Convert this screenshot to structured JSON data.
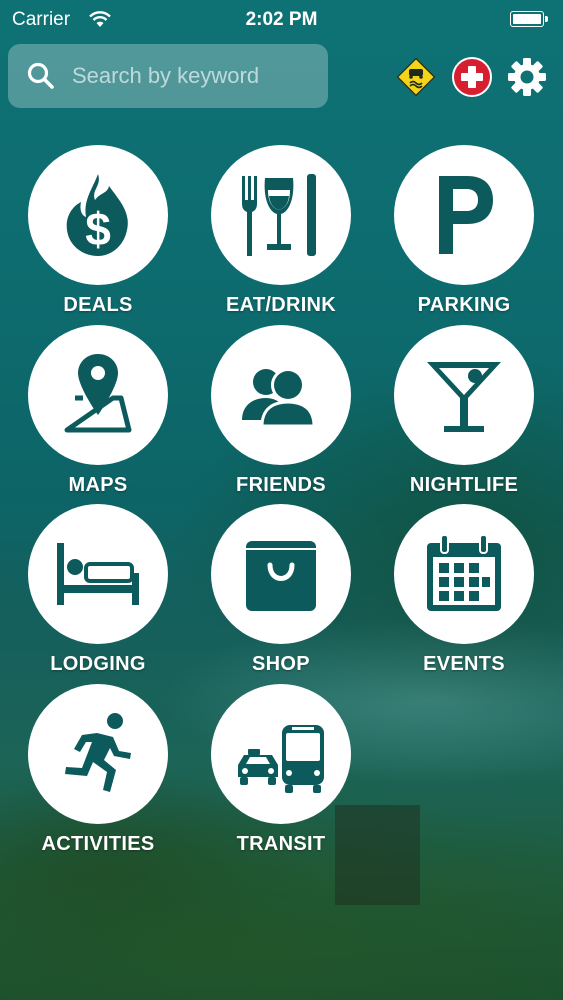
{
  "status_bar": {
    "carrier": "Carrier",
    "time": "2:02 PM"
  },
  "search": {
    "placeholder": "Search by keyword"
  },
  "header_icons": [
    {
      "name": "road-conditions-icon"
    },
    {
      "name": "emergency-icon"
    },
    {
      "name": "gear-icon"
    }
  ],
  "colors": {
    "tile_icon": "#0d5a5c",
    "emergency": "#d71f32",
    "road_sign": "#f4d418"
  },
  "categories": [
    {
      "label": "DEALS",
      "icon": "deals-fire-dollar-icon"
    },
    {
      "label": "EAT/DRINK",
      "icon": "fork-wine-knife-icon"
    },
    {
      "label": "PARKING",
      "icon": "parking-p-icon"
    },
    {
      "label": "MAPS",
      "icon": "map-pin-icon"
    },
    {
      "label": "FRIENDS",
      "icon": "friends-people-icon"
    },
    {
      "label": "NIGHTLIFE",
      "icon": "martini-glass-icon"
    },
    {
      "label": "LODGING",
      "icon": "bed-icon"
    },
    {
      "label": "SHOP",
      "icon": "shopping-bag-icon"
    },
    {
      "label": "EVENTS",
      "icon": "calendar-icon"
    },
    {
      "label": "ACTIVITIES",
      "icon": "running-person-icon"
    },
    {
      "label": "TRANSIT",
      "icon": "taxi-bus-icon"
    }
  ]
}
